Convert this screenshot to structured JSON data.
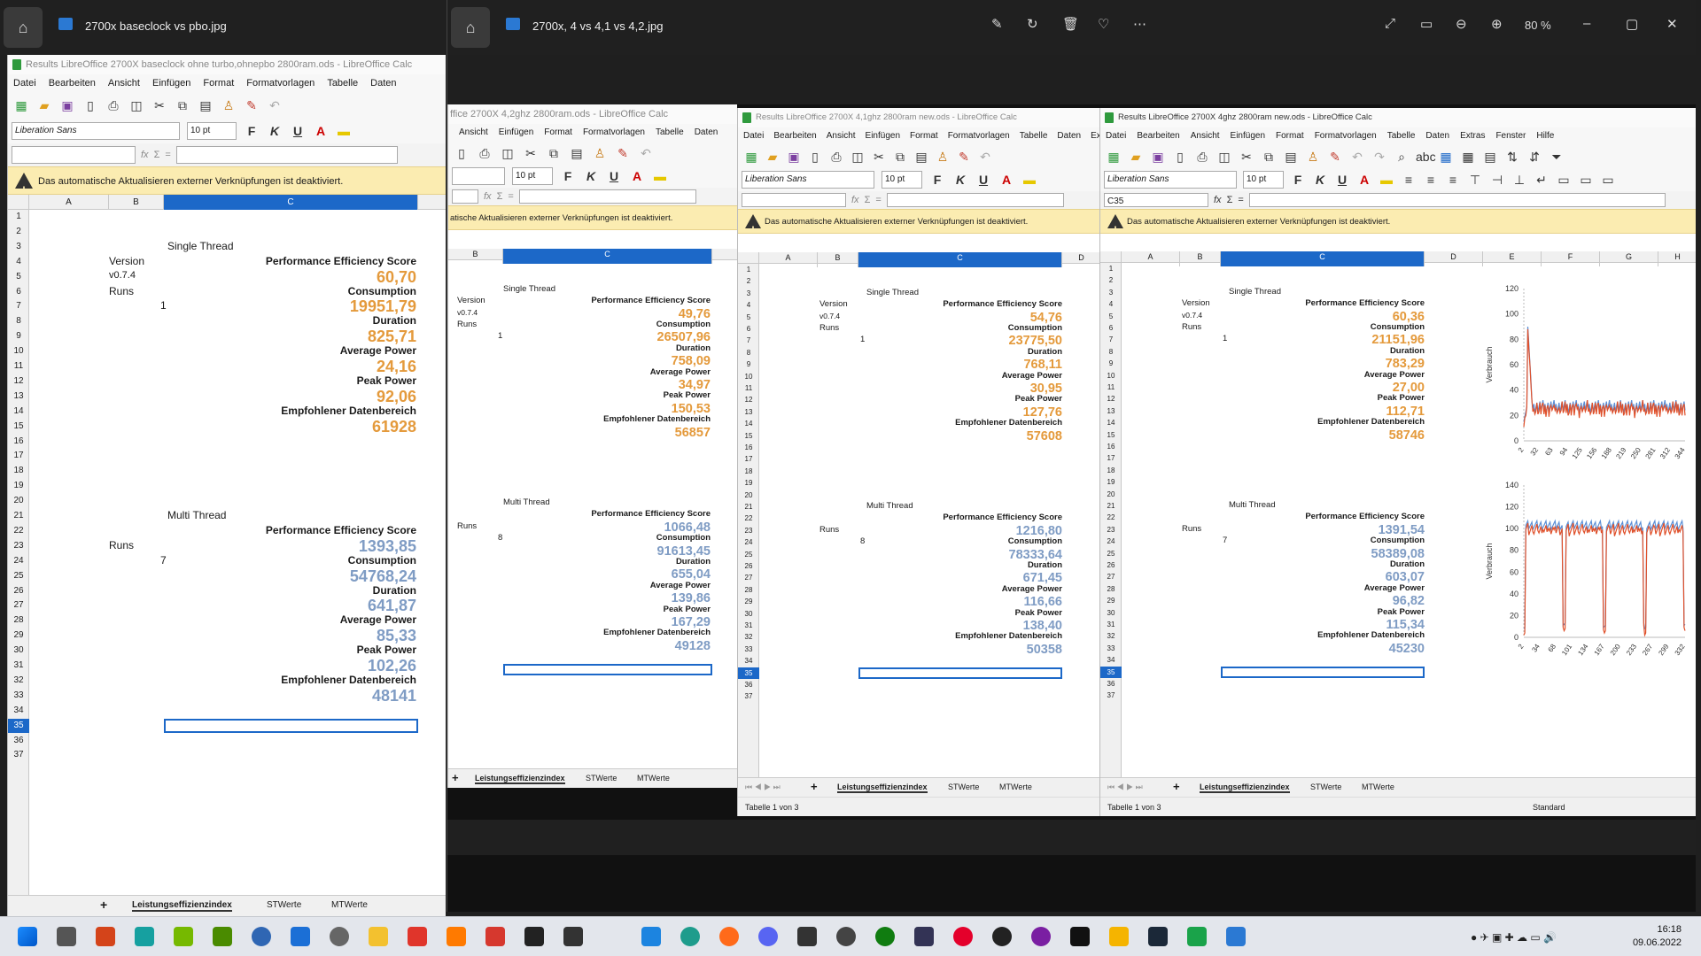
{
  "back_window": {
    "title": "2700x baseclock vs pbo.jpg"
  },
  "front_window": {
    "title": "2700x, 4 vs 4,1 vs 4,2.jpg",
    "zoom": "80 %"
  },
  "calc1": {
    "title": "Results LibreOffice 2700X baseclock ohne turbo,ohnepbo 2800ram.ods - LibreOffice Calc",
    "menu": [
      "Datei",
      "Bearbeiten",
      "Ansicht",
      "Einfügen",
      "Format",
      "Formatvorlagen",
      "Tabelle",
      "Daten"
    ],
    "font": "Liberation Sans",
    "size": "10 pt",
    "info": "Das automatische Aktualisieren externer Verknüpfungen ist deaktiviert.",
    "cols": [
      "A",
      "B",
      "C"
    ],
    "st": {
      "label": "Single Thread",
      "version_label": "Version",
      "version": "v0.7.4",
      "runs_label": "Runs",
      "runs": "1"
    },
    "mt": {
      "label": "Multi Thread",
      "runs_label": "Runs",
      "runs": "7"
    },
    "metrics": [
      "Performance Efficiency Score",
      "Consumption",
      "Duration",
      "Average Power",
      "Peak Power",
      "Empfohlener Datenbereich"
    ],
    "st_vals": [
      "60,70",
      "19951,79",
      "825,71",
      "24,16",
      "92,06",
      "61928"
    ],
    "mt_vals": [
      "1393,85",
      "54768,24",
      "641,87",
      "85,33",
      "102,26",
      "48141"
    ],
    "tabs": [
      "Leistungseffizienzindex",
      "STWerte",
      "MTWerte"
    ]
  },
  "calc2": {
    "title": "ffice 2700X 4,2ghz 2800ram.ods - LibreOffice Calc",
    "menu": [
      "Ansicht",
      "Einfügen",
      "Format",
      "Formatvorlagen",
      "Tabelle",
      "Daten"
    ],
    "size": "10 pt",
    "info": "atische Aktualisieren externer Verknüpfungen ist deaktiviert.",
    "st": {
      "label": "Single Thread",
      "version_label": "Version",
      "version": "v0.7.4",
      "runs_label": "Runs",
      "runs": "1"
    },
    "mt": {
      "label": "Multi Thread",
      "runs_label": "Runs",
      "runs": "8"
    },
    "metrics": [
      "Performance Efficiency Score",
      "Consumption",
      "Duration",
      "Average Power",
      "Peak Power",
      "Empfohlener Datenbereich"
    ],
    "st_vals": [
      "49,76",
      "26507,96",
      "758,09",
      "34,97",
      "150,53",
      "56857"
    ],
    "mt_vals": [
      "1066,48",
      "91613,45",
      "655,04",
      "139,86",
      "167,29",
      "49128"
    ],
    "tabs": [
      "Leistungseffizienzindex",
      "STWerte",
      "MTWerte"
    ]
  },
  "calc3": {
    "title": "Results LibreOffice 2700X 4,1ghz 2800ram new.ods - LibreOffice Calc",
    "menu": [
      "Datei",
      "Bearbeiten",
      "Ansicht",
      "Einfügen",
      "Format",
      "Formatvorlagen",
      "Tabelle",
      "Daten",
      "Ext"
    ],
    "font": "Liberation Sans",
    "size": "10 pt",
    "info": "Das automatische Aktualisieren externer Verknüpfungen ist deaktiviert.",
    "cols": [
      "A",
      "B",
      "C",
      "D"
    ],
    "st": {
      "label": "Single Thread",
      "version_label": "Version",
      "version": "v0.7.4",
      "runs_label": "Runs",
      "runs": "1"
    },
    "mt": {
      "label": "Multi Thread",
      "runs_label": "Runs",
      "runs": "8"
    },
    "metrics": [
      "Performance Efficiency Score",
      "Consumption",
      "Duration",
      "Average Power",
      "Peak Power",
      "Empfohlener Datenbereich"
    ],
    "st_vals": [
      "54,76",
      "23775,50",
      "768,11",
      "30,95",
      "127,76",
      "57608"
    ],
    "mt_vals": [
      "1216,80",
      "78333,64",
      "671,45",
      "116,66",
      "138,40",
      "50358"
    ],
    "tabs": [
      "Leistungseffizienzindex",
      "STWerte",
      "MTWerte"
    ],
    "status": "Tabelle 1 von 3"
  },
  "calc4": {
    "title": "Results LibreOffice 2700X 4ghz 2800ram new.ods - LibreOffice Calc",
    "menu": [
      "Datei",
      "Bearbeiten",
      "Ansicht",
      "Einfügen",
      "Format",
      "Formatvorlagen",
      "Tabelle",
      "Daten",
      "Extras",
      "Fenster",
      "Hilfe"
    ],
    "font": "Liberation Sans",
    "size": "10 pt",
    "cellref": "C35",
    "info": "Das automatische Aktualisieren externer Verknüpfungen ist deaktiviert.",
    "cols": [
      "A",
      "B",
      "C",
      "D",
      "E",
      "F",
      "G",
      "H"
    ],
    "st": {
      "label": "Single Thread",
      "version_label": "Version",
      "version": "v0.7.4",
      "runs_label": "Runs",
      "runs": "1"
    },
    "mt": {
      "label": "Multi Thread",
      "runs_label": "Runs",
      "runs": "7"
    },
    "metrics": [
      "Performance Efficiency Score",
      "Consumption",
      "Duration",
      "Average Power",
      "Peak Power",
      "Empfohlener Datenbereich"
    ],
    "st_vals": [
      "60,36",
      "21151,96",
      "783,29",
      "27,00",
      "112,71",
      "58746"
    ],
    "mt_vals": [
      "1391,54",
      "58389,08",
      "603,07",
      "96,82",
      "115,34",
      "45230"
    ],
    "tabs": [
      "Leistungseffizienzindex",
      "STWerte",
      "MTWerte"
    ],
    "status": "Tabelle 1 von 3",
    "status_style": "Standard"
  },
  "chart_data": [
    {
      "type": "line",
      "ylabel": "Verbrauch",
      "ylim": [
        0,
        120
      ],
      "yticks": [
        "120",
        "100",
        "80",
        "60",
        "40",
        "20",
        "0"
      ],
      "xticks": [
        "2",
        "32",
        "63",
        "94",
        "125",
        "156",
        "188",
        "219",
        "250",
        "281",
        "312",
        "344"
      ]
    },
    {
      "type": "line",
      "ylabel": "Verbrauch",
      "ylim": [
        0,
        140
      ],
      "yticks": [
        "140",
        "120",
        "100",
        "80",
        "60",
        "40",
        "20",
        "0"
      ],
      "xticks": [
        "2",
        "34",
        "68",
        "101",
        "134",
        "167",
        "200",
        "233",
        "267",
        "299",
        "332"
      ]
    }
  ],
  "clock": {
    "time": "16:18",
    "date": "09.06.2022"
  }
}
